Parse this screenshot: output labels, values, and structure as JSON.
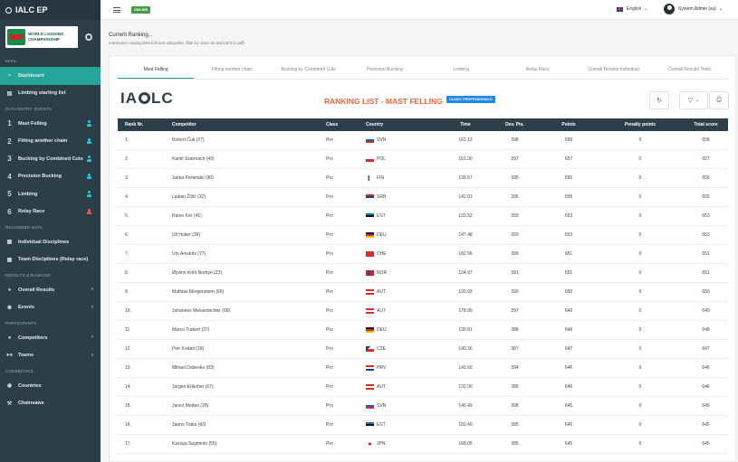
{
  "app": {
    "title": "IALC EP"
  },
  "sidebar": {
    "logo_lines": [
      "WORLD LOGGING",
      "CHAMPIONSHIP"
    ],
    "sections": {
      "main": "MAIN",
      "entry": "DATA ENTRY: EVENTS",
      "recorded": "RECORDED DATA",
      "results": "RESULTS & RANKING",
      "participants": "PARTICIPANTS",
      "codebooks": "CODEBOOKS"
    },
    "items": [
      {
        "label": "Dashboard"
      },
      {
        "label": "Limbing starting list"
      },
      {
        "label": "Mast Felling",
        "num": "1"
      },
      {
        "label": "Fitting another chain",
        "num": "2"
      },
      {
        "label": "Bucking by Combined Cuts",
        "num": "3"
      },
      {
        "label": "Precision Bucking",
        "num": "4"
      },
      {
        "label": "Limbing",
        "num": "5"
      },
      {
        "label": "Relay Race",
        "num": "6"
      },
      {
        "label": "Individual Disciplines"
      },
      {
        "label": "Team Disciplines (Relay race)"
      },
      {
        "label": "Overall Results"
      },
      {
        "label": "Events"
      },
      {
        "label": "Competitors"
      },
      {
        "label": "Teams"
      },
      {
        "label": "Countries"
      },
      {
        "label": "Chainsaws"
      }
    ]
  },
  "topbar": {
    "status": "ONLINE",
    "language": "English",
    "user": "System Admin (sa)"
  },
  "header": {
    "title": "Current Ranking...",
    "subtitle": "Interactive ranking lists (choose discipline, filter by class as and print to pdf)"
  },
  "tabs": [
    "Mast Felling",
    "Fitting another chain",
    "Bucking by Combined Cuts",
    "Precision Bucking",
    "Limbing",
    "Relay Race",
    "Overall Results Individual",
    "Overall Results Team"
  ],
  "ranking": {
    "brand": "IALC",
    "title": "RANKING LIST - MAST FELLING",
    "class_badge": "CLASS: PROFESSIONALS"
  },
  "table": {
    "headers": [
      "Rank Nr.",
      "Competitor",
      "Class",
      "Country",
      "Time",
      "Dev. Pts.",
      "Points",
      "Penalty points",
      "Total score"
    ],
    "rows": [
      [
        "1.",
        "Robert Čuk (27)",
        "Pro",
        "SVN",
        "162.12",
        "398",
        "658",
        "0",
        "658"
      ],
      [
        "2.",
        "Kamil Szarmach (49)",
        "Pro",
        "POL",
        "161.30",
        "397",
        "657",
        "0",
        "657"
      ],
      [
        "3.",
        "Jukka Perämäki (90)",
        "Pro",
        "FIN",
        "139.57",
        "395",
        "655",
        "0",
        "655"
      ],
      [
        "4.",
        "Ljuban Žižić (32)",
        "Pro",
        "SRB",
        "142.01",
        "395",
        "655",
        "0",
        "655"
      ],
      [
        "5.",
        "Raino Kivi (41)",
        "Pro",
        "EST",
        "133.52",
        "393",
        "653",
        "0",
        "653"
      ],
      [
        "6.",
        "Uli Huber (38)",
        "Pro",
        "DEU",
        "147.48",
        "393",
        "653",
        "0",
        "653"
      ],
      [
        "7.",
        "Urs Amstutz (77)",
        "Pro",
        "CHE",
        "182.96",
        "399",
        "651",
        "0",
        "651"
      ],
      [
        "8.",
        "Øyvinn Kohl-Norbye (22)",
        "Pro",
        "NOR",
        "124.97",
        "391",
        "651",
        "0",
        "651"
      ],
      [
        "9.",
        "Mathias Morgenstern (65)",
        "Pro",
        "AUT",
        "120.92",
        "390",
        "650",
        "0",
        "650"
      ],
      [
        "10.",
        "Johannes Meisenbichler (68)",
        "Pro",
        "AUT",
        "178.99",
        "397",
        "649",
        "0",
        "649"
      ],
      [
        "11.",
        "Marco Trabert (37)",
        "Pro",
        "DEU",
        "130.91",
        "388",
        "648",
        "0",
        "648"
      ],
      [
        "12.",
        "Petr Kodad (18)",
        "Pro",
        "CZE",
        "140.36",
        "387",
        "647",
        "0",
        "647"
      ],
      [
        "13.",
        "Mihael Dobenko (83)",
        "Pro",
        "HRV",
        "143.60",
        "394",
        "646",
        "0",
        "646"
      ],
      [
        "14.",
        "Jürgen Erlacher (67)",
        "Pro",
        "AUT",
        "132.00",
        "386",
        "646",
        "0",
        "646"
      ],
      [
        "15.",
        "Janez Medeo (28)",
        "Pro",
        "SVN",
        "149.49",
        "398",
        "645",
        "0",
        "645"
      ],
      [
        "16.",
        "Jaano Traks (42)",
        "Pro",
        "EST",
        "150.40",
        "395",
        "645",
        "0",
        "645"
      ],
      [
        "17.",
        "Kazuya Sugimoto (55)",
        "Pro",
        "JPN",
        "168.05",
        "385",
        "645",
        "0",
        "645"
      ]
    ]
  },
  "colors": {
    "sidebar": "#2c3e4a",
    "accent": "#26a69a",
    "title": "#e8623c",
    "badge": "#1e88e5"
  }
}
